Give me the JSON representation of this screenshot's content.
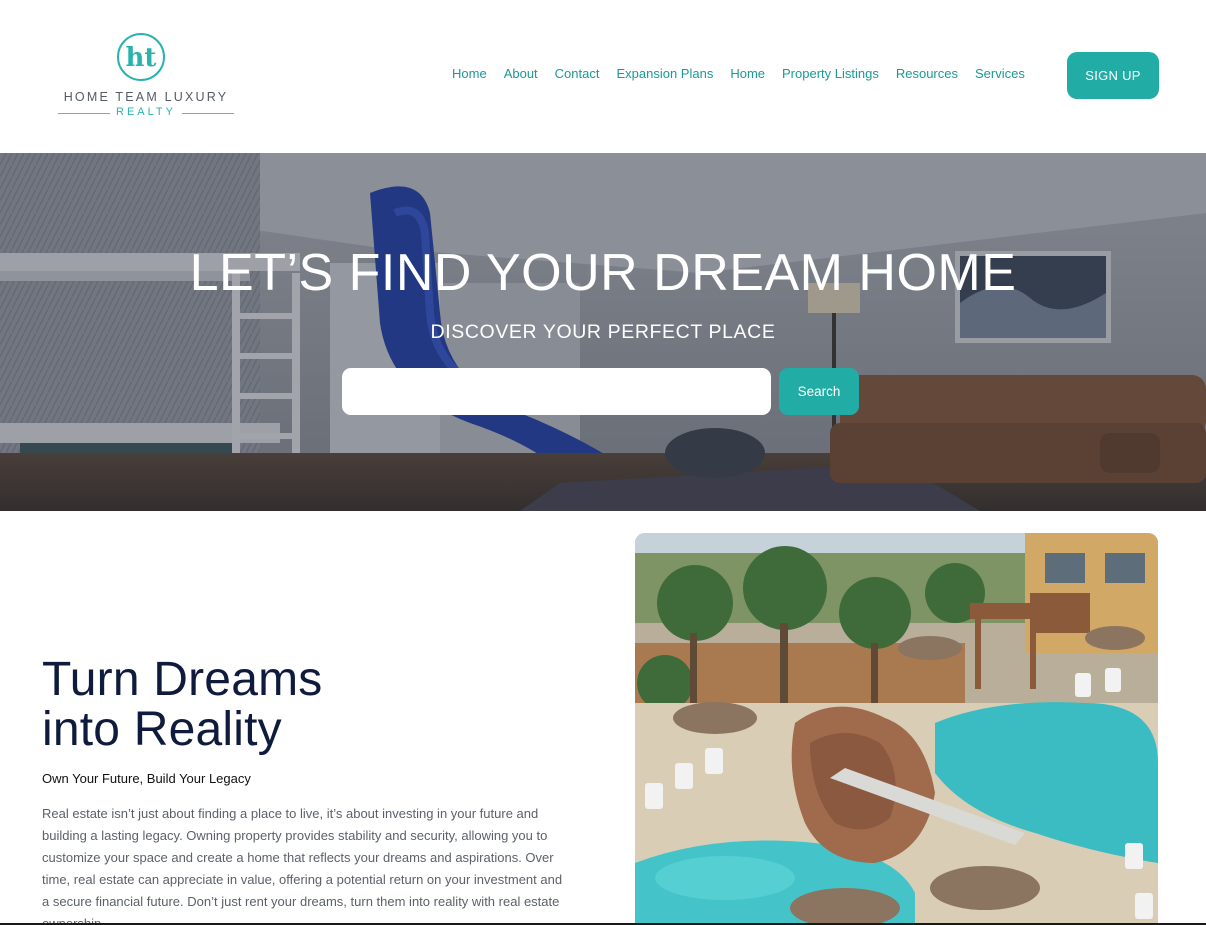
{
  "brand": {
    "monogram": "ht",
    "line1": "HOME TEAM LUXURY",
    "line2": "REALTY",
    "accent": "#22aca6"
  },
  "nav": {
    "items": [
      {
        "label": "Home"
      },
      {
        "label": "About"
      },
      {
        "label": "Contact"
      },
      {
        "label": "Expansion Plans"
      },
      {
        "label": "Home"
      },
      {
        "label": "Property Listings"
      },
      {
        "label": "Resources"
      },
      {
        "label": "Services"
      }
    ],
    "signup_label": "SIGN UP"
  },
  "hero": {
    "title": "LET’S FIND YOUR DREAM HOME",
    "subtitle": "DISCOVER YOUR PERFECT PLACE",
    "search_value": "",
    "search_button": "Search"
  },
  "content": {
    "title_line1": "Turn Dreams",
    "title_line2": "into Reality",
    "tagline": "Own Your Future, Build Your Legacy",
    "body": "Real estate isn’t just about finding a place to live, it’s about investing in your future and building a lasting legacy. Owning property provides stability and security, allowing you to customize your space and create a home that reflects your dreams and aspirations. Over time, real estate can appreciate in value, offering a potential return on your investment and a secure financial future. Don’t just rent your dreams, turn them into reality with real estate ownership."
  },
  "colors": {
    "title_navy": "#0e1b3d",
    "nav_teal": "#1a9a94",
    "button_teal": "#22aca6"
  }
}
